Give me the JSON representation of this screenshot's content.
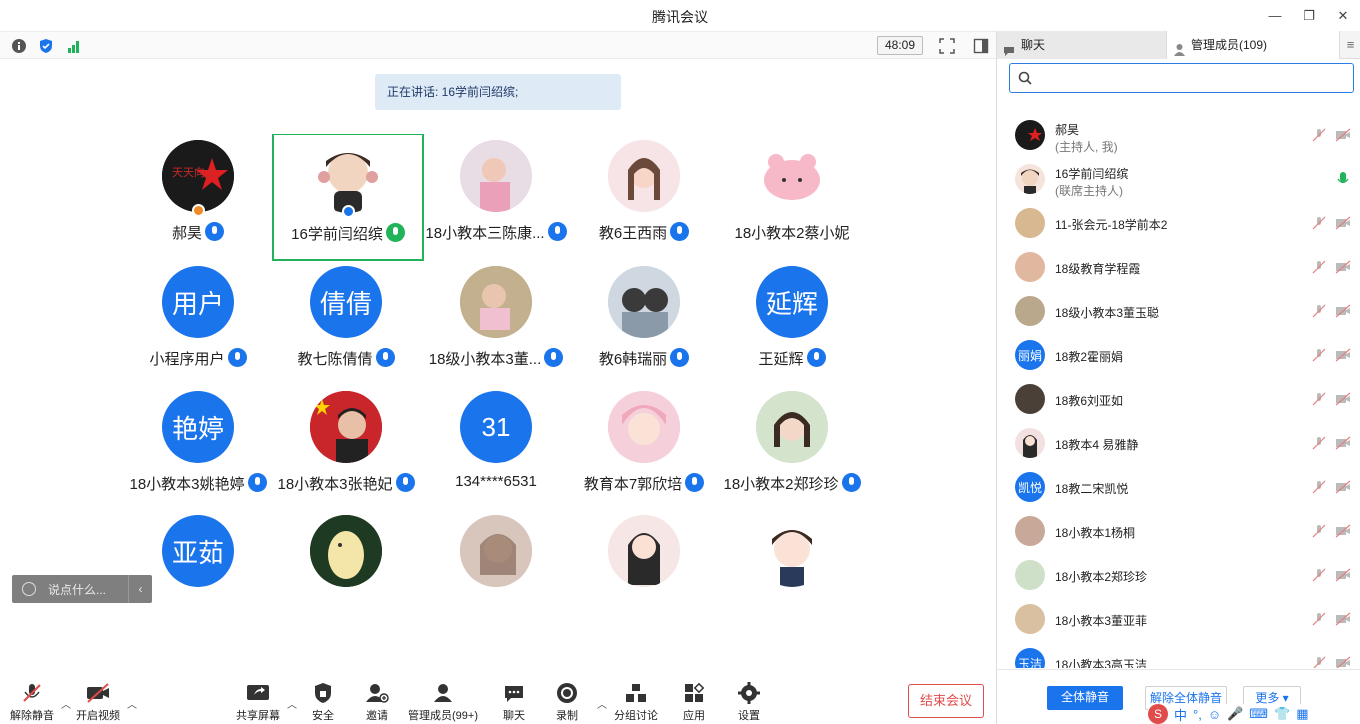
{
  "window": {
    "title": "腾讯会议",
    "timer": "48:09"
  },
  "banner": {
    "speaking": "正在讲话: 16学前闫绍缤;"
  },
  "grid": {
    "tiles": [
      {
        "name": "郝昊",
        "initials": ""
      },
      {
        "name": "16学前闫绍缤",
        "initials": ""
      },
      {
        "name": "18小教本三陈康...",
        "initials": ""
      },
      {
        "name": "教6王西雨",
        "initials": ""
      },
      {
        "name": "18小教本2蔡小妮",
        "initials": ""
      },
      {
        "name": "小程序用户",
        "initials": "用户"
      },
      {
        "name": "教七陈倩倩",
        "initials": "倩倩"
      },
      {
        "name": "18级小教本3董...",
        "initials": ""
      },
      {
        "name": "教6韩瑞丽",
        "initials": ""
      },
      {
        "name": "王延辉",
        "initials": "延辉"
      },
      {
        "name": "18小教本3姚艳婷",
        "initials": "艳婷"
      },
      {
        "name": "18小教本3张艳妃",
        "initials": ""
      },
      {
        "name": "134****6531",
        "initials": "31"
      },
      {
        "name": "教育本7郭欣培",
        "initials": ""
      },
      {
        "name": "18小教本2郑珍珍",
        "initials": ""
      },
      {
        "name": "",
        "initials": "亚茹"
      },
      {
        "name": "",
        "initials": ""
      },
      {
        "name": "",
        "initials": ""
      },
      {
        "name": "",
        "initials": ""
      },
      {
        "name": "",
        "initials": ""
      }
    ]
  },
  "chat_input": {
    "placeholder": "说点什么..."
  },
  "toolbar": {
    "unmute": "解除静音",
    "start_video": "开启视频",
    "share": "共享屏幕",
    "security": "安全",
    "invite": "邀请",
    "members": "管理成员(99+)",
    "chat": "聊天",
    "record": "录制",
    "breakout": "分组讨论",
    "apps": "应用",
    "settings": "设置",
    "end": "结束会议"
  },
  "panel": {
    "tab_chat": "聊天",
    "tab_members": "管理成员(109)",
    "members": [
      {
        "name": "郝昊",
        "sub": "(主持人, 我)",
        "initials": ""
      },
      {
        "name": "16学前闫绍缤",
        "sub": "(联席主持人)",
        "initials": ""
      },
      {
        "name": "11-张会元-18学前本2",
        "sub": "",
        "initials": ""
      },
      {
        "name": "18级教育学程霞",
        "sub": "",
        "initials": ""
      },
      {
        "name": "18级小教本3董玉聪",
        "sub": "",
        "initials": ""
      },
      {
        "name": "18教2霍丽娟",
        "sub": "",
        "initials": "丽娟"
      },
      {
        "name": "18教6刘亚如",
        "sub": "",
        "initials": ""
      },
      {
        "name": "18教本4  易雅静",
        "sub": "",
        "initials": ""
      },
      {
        "name": "18教二宋凯悦",
        "sub": "",
        "initials": "凯悦"
      },
      {
        "name": "18小教本1杨桐",
        "sub": "",
        "initials": ""
      },
      {
        "name": "18小教本2郑珍珍",
        "sub": "",
        "initials": ""
      },
      {
        "name": "18小教本3董亚菲",
        "sub": "",
        "initials": ""
      },
      {
        "name": "18小教本3高玉洁",
        "sub": "",
        "initials": "玉洁"
      }
    ],
    "mute_all": "全体静音",
    "unmute_all": "解除全体静音",
    "more": "更多 ▾"
  },
  "ime": {
    "label": "中"
  },
  "colors": {
    "accent": "#1a74ec",
    "active": "#21b35a",
    "danger": "#e04b4b"
  }
}
